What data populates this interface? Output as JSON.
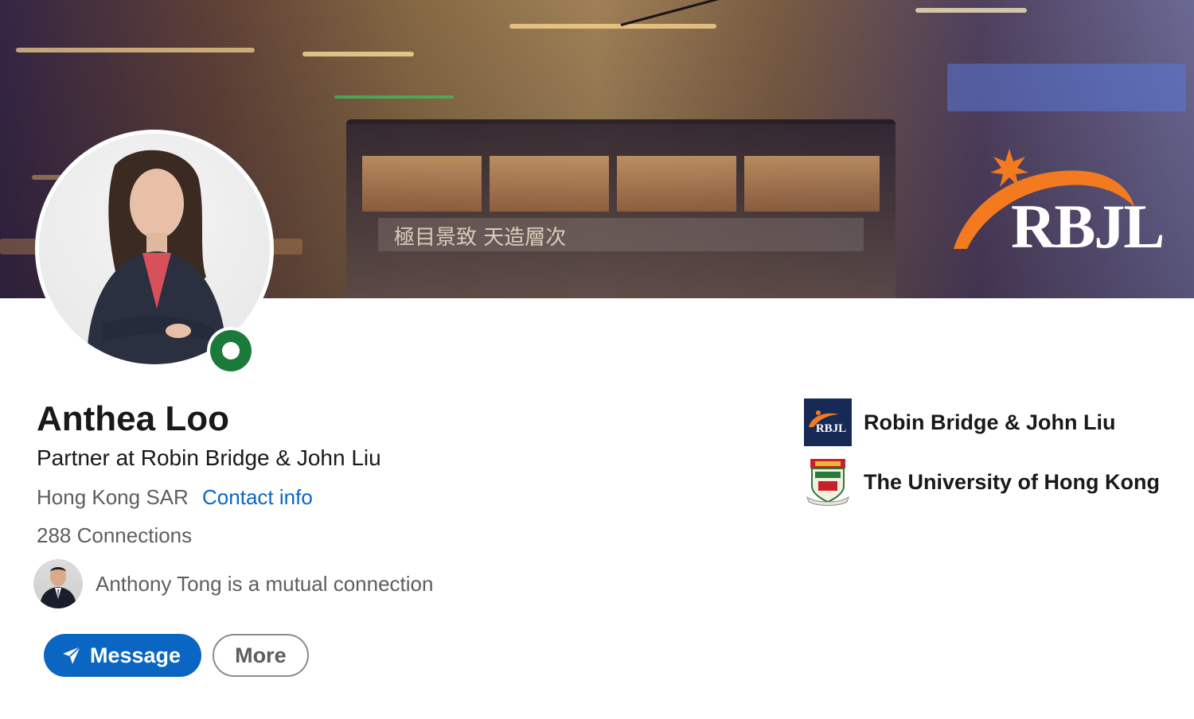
{
  "profile": {
    "name": "Anthea Loo",
    "headline": "Partner at Robin Bridge & John Liu",
    "location": "Hong Kong SAR",
    "contact_label": "Contact info",
    "connections": "288 Connections"
  },
  "banner": {
    "brand_text": "RBJL",
    "sign_text": "極目景致 天造層次"
  },
  "mutual": {
    "name": "Anthony Tong",
    "suffix": " is a mutual connection"
  },
  "actions": {
    "message_label": "Message",
    "more_label": "More"
  },
  "organizations": [
    {
      "name": "Robin Bridge & John Liu",
      "logo_text": "RBJL",
      "icon": "rbjl-logo-icon"
    },
    {
      "name": "The University of Hong Kong",
      "icon": "hku-crest-icon"
    }
  ],
  "colors": {
    "primary": "#0a66c2",
    "open_to_work": "#1b7a3a",
    "brand_orange": "#f47a20",
    "brand_navy": "#172a55"
  }
}
